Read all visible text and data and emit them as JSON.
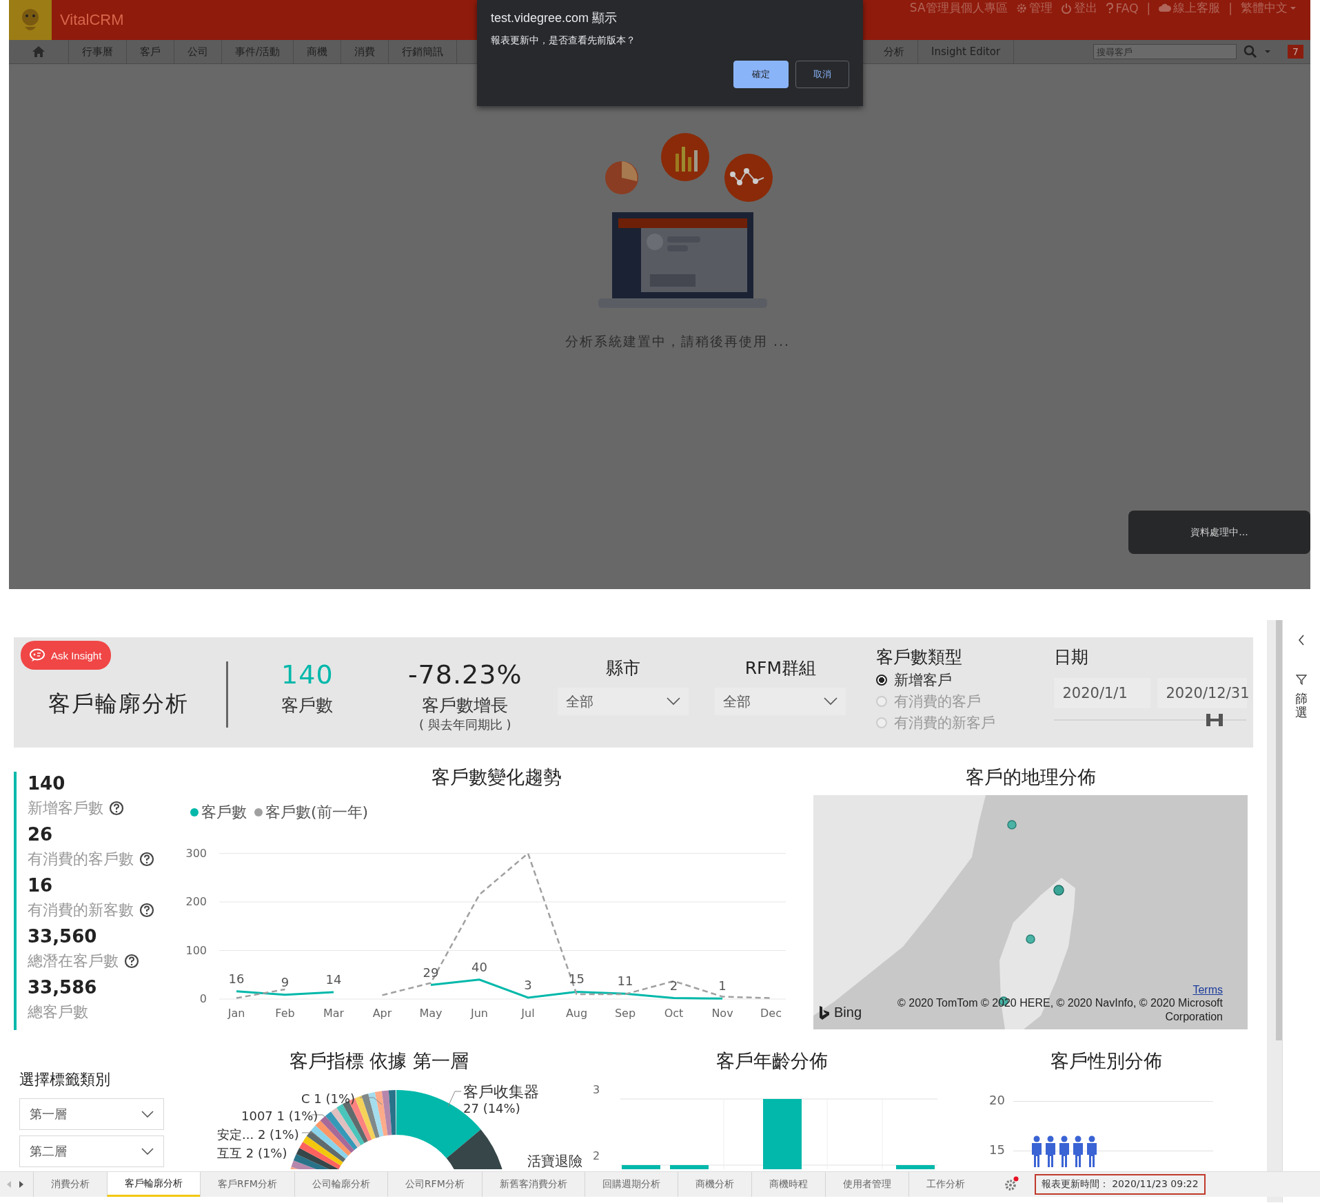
{
  "app": {
    "name": "VitalCRM",
    "top_links": [
      {
        "kind": "text",
        "label": "SA管理員個人專區"
      },
      {
        "kind": "gear",
        "label": "管理"
      },
      {
        "kind": "power",
        "label": "登出"
      },
      {
        "kind": "help",
        "label": "FAQ"
      },
      {
        "kind": "divider",
        "label": "|"
      },
      {
        "kind": "cloud",
        "label": "線上客服"
      },
      {
        "kind": "divider",
        "label": "|"
      },
      {
        "kind": "language",
        "label": "繁體中文"
      }
    ]
  },
  "nav": {
    "left": [
      "行事曆",
      "客戶",
      "公司",
      "事件/活動",
      "商機",
      "消費",
      "行銷簡訊"
    ],
    "right": [
      "分析",
      "Insight Editor"
    ],
    "search": {
      "placeholder": "搜尋客戶"
    },
    "badge": "7"
  },
  "dialog": {
    "title": "test.videgree.com 顯示",
    "message": "報表更新中，是否查看先前版本？",
    "buttons": [
      {
        "label": "確定",
        "kind": "primary"
      },
      {
        "label": "取消",
        "kind": "secondary"
      }
    ]
  },
  "loading": {
    "message": "分析系統建置中，請稍後再使用 ...",
    "toast": "資料處理中..."
  },
  "report": {
    "ask_button": "Ask Insight",
    "title": "客戶輪廓分析",
    "kpis": [
      {
        "value": "140",
        "label": "客戶數",
        "kind": "accent"
      },
      {
        "value": "-78.23%",
        "label": "客戶數增長",
        "note": "( 與去年同期比 )",
        "kind": "plain"
      }
    ],
    "filters": [
      {
        "label": "縣市",
        "value": "全部"
      },
      {
        "label": "RFM群組",
        "value": "全部"
      }
    ],
    "customer_type": {
      "label": "客戶數類型",
      "options": [
        {
          "label": "新增客戶",
          "selected": true
        },
        {
          "label": "有消費的客戶",
          "selected": false
        },
        {
          "label": "有消費的新客戶",
          "selected": false
        }
      ]
    },
    "date": {
      "label": "日期",
      "from": "2020/1/1",
      "to": "2020/12/31"
    },
    "stats": [
      {
        "value": "140",
        "label": "新增客戶數",
        "help": true
      },
      {
        "value": "26",
        "label": "有消費的客戶數",
        "help": true
      },
      {
        "value": "16",
        "label": "有消費的新客數",
        "help": true
      },
      {
        "value": "33,560",
        "label": "總潛在客戶數",
        "help": true
      },
      {
        "value": "33,586",
        "label": "總客戶數",
        "help": false
      }
    ],
    "trend": {
      "chart_data": {
        "type": "line",
        "title": "客戶數變化趨勢",
        "categories": [
          "Jan",
          "Feb",
          "Mar",
          "Apr",
          "May",
          "Jun",
          "Jul",
          "Aug",
          "Sep",
          "Oct",
          "Nov",
          "Dec"
        ],
        "series": [
          {
            "name": "客戶數",
            "color": "#01b8aa",
            "line_style": "solid",
            "values": [
              16,
              9,
              14,
              null,
              29,
              40,
              3,
              15,
              11,
              2,
              1,
              null
            ],
            "value_labels": [
              "16",
              "9",
              "14",
              null,
              "29",
              "40",
              "3",
              "15",
              "11",
              "2",
              "1",
              null
            ]
          },
          {
            "name": "客戶數(前一年)",
            "color": "#a0a0a0",
            "line_style": "dashed",
            "values": [
              2,
              20,
              null,
              8,
              33,
              215,
              300,
              10,
              10,
              37,
              5,
              2
            ]
          }
        ],
        "legend": "top-left",
        "grid": "y",
        "ylim": [
          0,
          300
        ],
        "yticks": [
          0,
          100,
          200,
          300
        ]
      }
    },
    "map": {
      "title": "客戶的地理分佈",
      "terms": "Terms",
      "credit": "© 2020 TomTom © 2020 HERE, © 2020 NavInfo, © 2020 Microsoft Corporation",
      "brand": "Bing"
    },
    "tag_select": {
      "label": "選擇標籤類別",
      "dropdowns": [
        "第一層",
        "第二層"
      ]
    },
    "segments": {
      "title": "客戶指標 依據 第一層",
      "labels": [
        "C 1 (1%)",
        "1007 1 (1%)",
        "安定... 2 (1%)",
        "互互 2 (1%)"
      ],
      "main_label": "客戶收集器",
      "main_value": "27 (14%)",
      "side_label": "活寶退險"
    },
    "age": {
      "title": "客戶年齡分佈",
      "yticks": [
        "3",
        "2"
      ]
    },
    "gender": {
      "title": "客戶性別分佈",
      "yticks": [
        "20",
        "15"
      ]
    },
    "side_pane": {
      "label": "篩選"
    },
    "tabs": [
      {
        "label": "消費分析",
        "selected": false
      },
      {
        "label": "客戶輪廓分析",
        "selected": true
      },
      {
        "label": "客戶RFM分析",
        "selected": false
      },
      {
        "label": "公司輪廓分析",
        "selected": false
      },
      {
        "label": "公司RFM分析",
        "selected": false
      },
      {
        "label": "新舊客消費分析",
        "selected": false
      },
      {
        "label": "回購週期分析",
        "selected": false
      },
      {
        "label": "商機分析",
        "selected": false
      },
      {
        "label": "商機時程",
        "selected": false
      },
      {
        "label": "使用者管理",
        "selected": false
      },
      {
        "label": "工作分析",
        "selected": false
      }
    ],
    "updated": "報表更新時間： 2020/11/23 09:22"
  }
}
